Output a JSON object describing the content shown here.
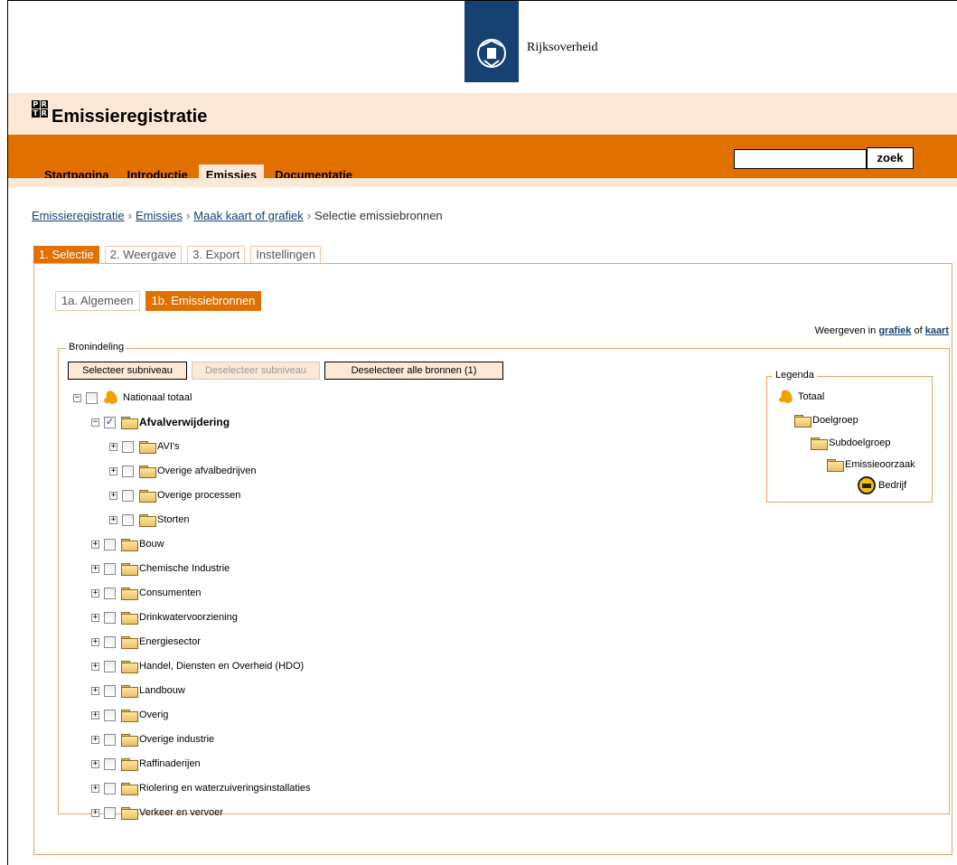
{
  "header": {
    "brand_text": "Rijksoverheid",
    "site_title": "Emissieregistratie",
    "logo_letters": [
      "P",
      "R",
      "T",
      "R"
    ]
  },
  "nav": {
    "tabs": [
      {
        "label": "Startpagina",
        "active": false
      },
      {
        "label": "Introductie",
        "active": false
      },
      {
        "label": "Emissies",
        "active": true
      },
      {
        "label": "Documentatie",
        "active": false
      }
    ],
    "search_button": "zoek",
    "search_value": ""
  },
  "breadcrumb": {
    "items": [
      "Emissieregistratie",
      "Emissies",
      "Maak kaart of grafiek"
    ],
    "current": "Selectie emissiebronnen",
    "separator": "›"
  },
  "step_tabs": [
    {
      "label": "1. Selectie",
      "active": true
    },
    {
      "label": "2. Weergave",
      "active": false
    },
    {
      "label": "3. Export",
      "active": false
    },
    {
      "label": "Instellingen",
      "active": false
    }
  ],
  "sub_tabs": [
    {
      "label": "1a. Algemeen",
      "active": false
    },
    {
      "label": "1b. Emissiebronnen",
      "active": true
    }
  ],
  "weergeven": {
    "prefix": "Weergeven in",
    "link1": "grafiek",
    "middle": "of",
    "link2": "kaart"
  },
  "bronindeling": {
    "legend": "Bronindeling",
    "buttons": {
      "select_sub": "Selecteer subniveau",
      "deselect_sub": "Deselecteer subniveau",
      "deselect_all": "Deselecteer alle bronnen (1)"
    },
    "tree": {
      "root": "Nationaal totaal",
      "selected": "Afvalverwijdering",
      "children_selected": [
        "AVI's",
        "Overige afvalbedrijven",
        "Overige processen",
        "Storten"
      ],
      "siblings": [
        "Bouw",
        "Chemische Industrie",
        "Consumenten",
        "Drinkwatervoorziening",
        "Energiesector",
        "Handel, Diensten en Overheid (HDO)",
        "Landbouw",
        "Overig",
        "Overige industrie",
        "Raffinaderijen",
        "Riolering en waterzuiveringsinstallaties",
        "Verkeer en vervoer"
      ]
    }
  },
  "legenda": {
    "title": "Legenda",
    "items": [
      "Totaal",
      "Doelgroep",
      "Subdoelgroep",
      "Emissieoorzaak",
      "Bedrijf"
    ]
  },
  "colors": {
    "accent": "#e17000",
    "band": "#fbe8d6",
    "brand": "#154273"
  },
  "icons": {
    "expand": "plus-box-icon",
    "collapse": "minus-box-icon",
    "folder": "folder-icon",
    "total": "netherlands-map-icon",
    "company": "factory-icon"
  }
}
